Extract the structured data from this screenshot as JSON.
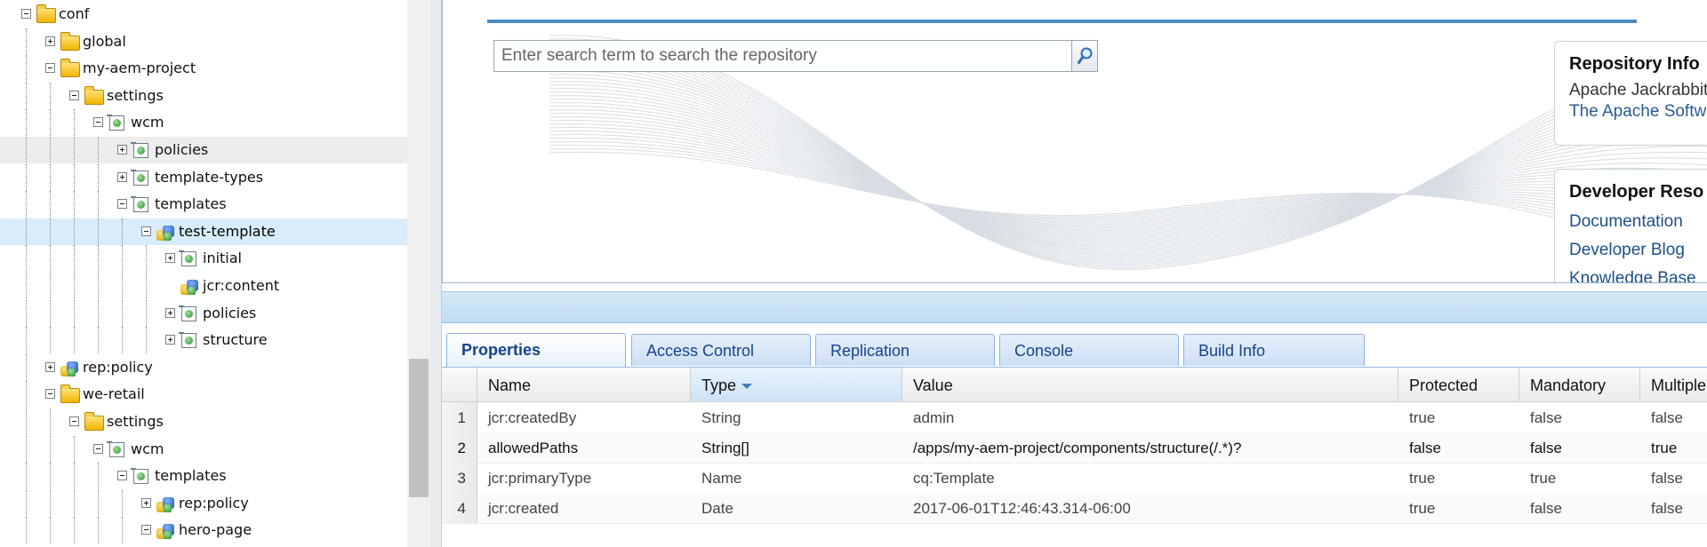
{
  "tree": {
    "nodes": [
      {
        "label": "conf",
        "icon": "folder-icon",
        "toggle": "minus",
        "depth": 0
      },
      {
        "label": "global",
        "icon": "folder-icon",
        "toggle": "plus",
        "depth": 1
      },
      {
        "label": "my-aem-project",
        "icon": "folder-icon",
        "toggle": "minus",
        "depth": 1
      },
      {
        "label": "settings",
        "icon": "folder-icon",
        "toggle": "minus",
        "depth": 2
      },
      {
        "label": "wcm",
        "icon": "node-icon",
        "toggle": "minus",
        "depth": 3
      },
      {
        "label": "policies",
        "icon": "node-icon",
        "toggle": "plus",
        "depth": 4
      },
      {
        "label": "template-types",
        "icon": "node-icon",
        "toggle": "plus",
        "depth": 4
      },
      {
        "label": "templates",
        "icon": "node-icon",
        "toggle": "minus",
        "depth": 4
      },
      {
        "label": "test-template",
        "icon": "people-icon",
        "toggle": "minus",
        "depth": 5
      },
      {
        "label": "initial",
        "icon": "node-icon",
        "toggle": "plus",
        "depth": 6
      },
      {
        "label": "jcr:content",
        "icon": "people-icon",
        "toggle": "none",
        "depth": 6
      },
      {
        "label": "policies",
        "icon": "node-icon",
        "toggle": "plus",
        "depth": 6
      },
      {
        "label": "structure",
        "icon": "node-icon",
        "toggle": "plus",
        "depth": 6
      },
      {
        "label": "rep:policy",
        "icon": "people-icon",
        "toggle": "plus",
        "depth": 1
      },
      {
        "label": "we-retail",
        "icon": "folder-icon",
        "toggle": "minus",
        "depth": 1
      },
      {
        "label": "settings",
        "icon": "folder-icon",
        "toggle": "minus",
        "depth": 2
      },
      {
        "label": "wcm",
        "icon": "node-icon",
        "toggle": "minus",
        "depth": 3
      },
      {
        "label": "templates",
        "icon": "node-icon",
        "toggle": "minus",
        "depth": 4
      },
      {
        "label": "rep:policy",
        "icon": "people-icon",
        "toggle": "plus",
        "depth": 5
      },
      {
        "label": "hero-page",
        "icon": "people-icon",
        "toggle": "minus",
        "depth": 5
      }
    ],
    "hover_index": 5,
    "selected_index": 8
  },
  "search": {
    "placeholder": "Enter search term to search the repository"
  },
  "repository_info": {
    "title": "Repository Info",
    "lines": [
      "Apache Jackrabbit",
      "The Apache Software"
    ]
  },
  "developer_resources": {
    "title": "Developer Reso",
    "links": [
      "Documentation",
      "Developer Blog",
      "Knowledge Base"
    ]
  },
  "tabs": [
    "Properties",
    "Access Control",
    "Replication",
    "Console",
    "Build Info"
  ],
  "active_tab": "Properties",
  "grid": {
    "columns": [
      "Name",
      "Type",
      "Value",
      "Protected",
      "Mandatory",
      "Multiple"
    ],
    "sorted_column": "Type",
    "rows": [
      {
        "num": "1",
        "name": "jcr:createdBy",
        "type": "String",
        "value": "admin",
        "protected": "true",
        "mandatory": "false",
        "multiple": "false",
        "bold": false
      },
      {
        "num": "2",
        "name": "allowedPaths",
        "type": "String[]",
        "value": "/apps/my-aem-project/components/structure(/.*)?",
        "protected": "false",
        "mandatory": "false",
        "multiple": "true",
        "bold": true
      },
      {
        "num": "3",
        "name": "jcr:primaryType",
        "type": "Name",
        "value": "cq:Template",
        "protected": "true",
        "mandatory": "true",
        "multiple": "false",
        "bold": false
      },
      {
        "num": "4",
        "name": "jcr:created",
        "type": "Date",
        "value": "2017-06-01T12:46:43.314-06:00",
        "protected": "true",
        "mandatory": "false",
        "multiple": "false",
        "bold": false
      }
    ]
  },
  "colors": {
    "accent": "#4a8bc2",
    "tab_text": "#15428b",
    "selected_row": "#d9ecfb",
    "link": "#1d4f8a"
  }
}
